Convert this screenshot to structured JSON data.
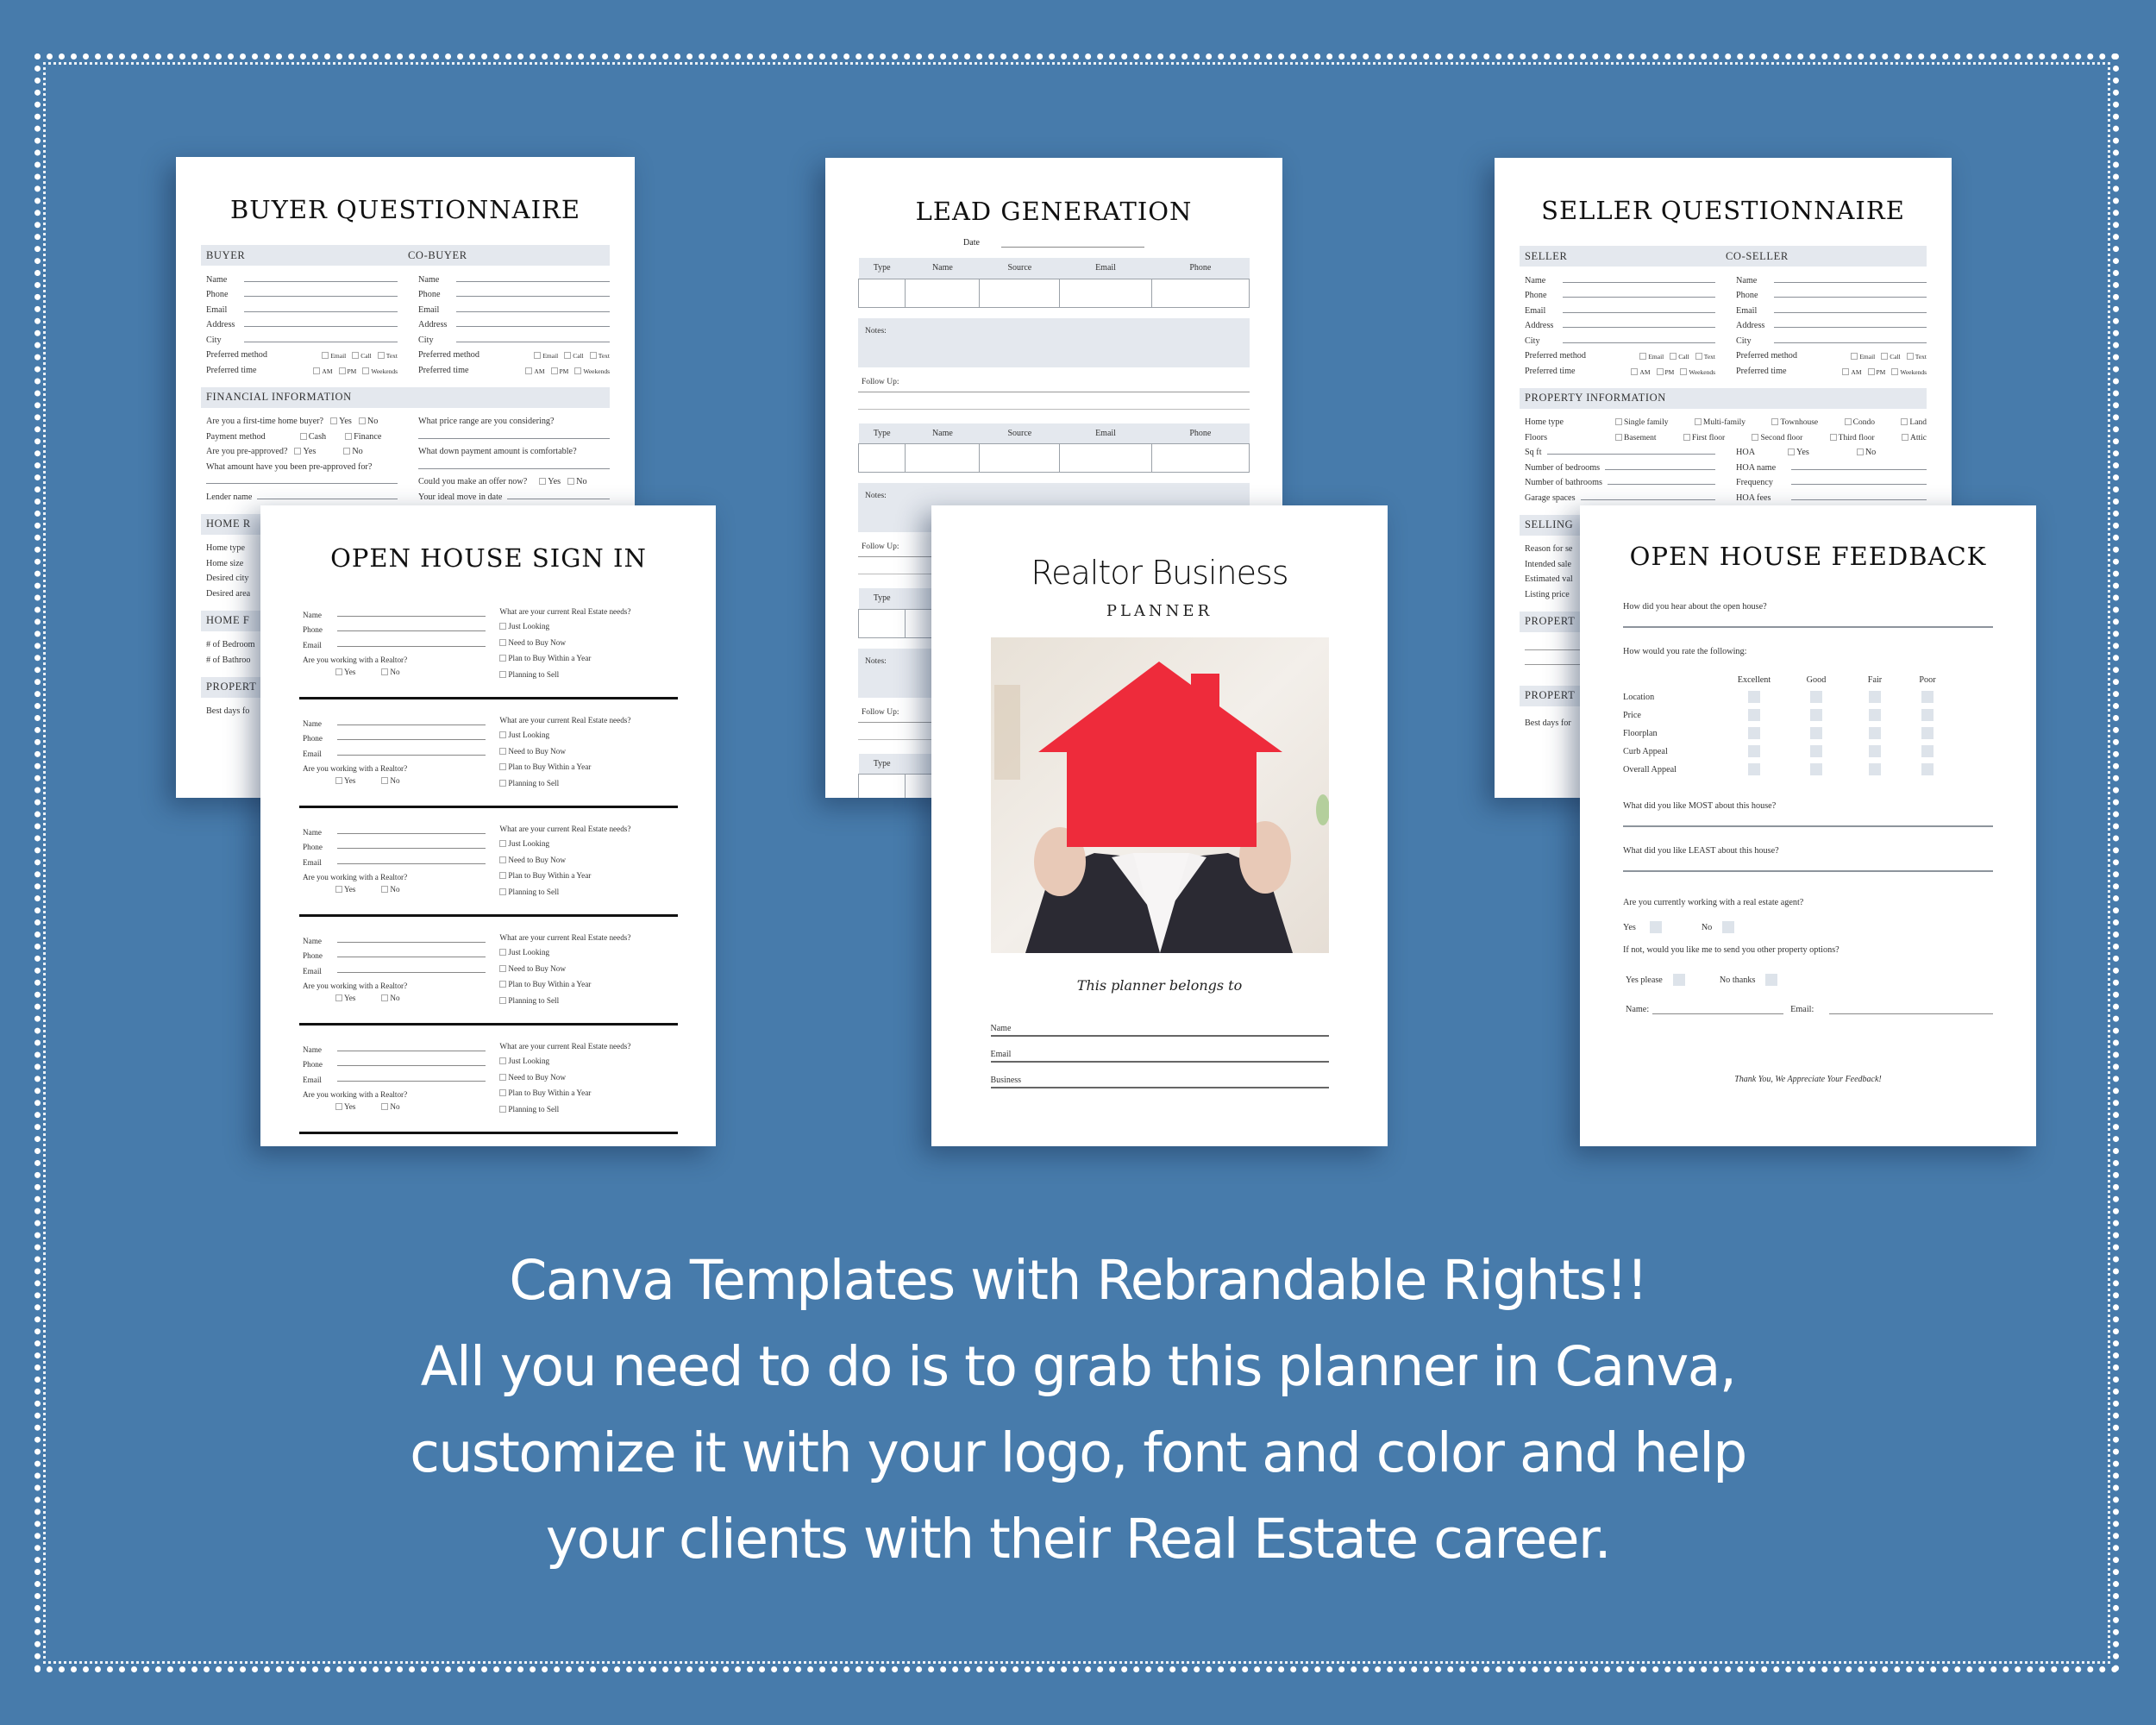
{
  "background_color": "#477bab",
  "buyer": {
    "title": "BUYER QUESTIONNAIRE",
    "section_buyer": "BUYER",
    "section_cobuyer": "CO-BUYER",
    "fields": [
      "Name",
      "Phone",
      "Email",
      "Address",
      "City"
    ],
    "preferred_method": "Preferred method",
    "method_options": [
      "Email",
      "Call",
      "Text"
    ],
    "preferred_time": "Preferred time",
    "time_options": [
      "AM",
      "PM",
      "Weekends"
    ],
    "financial_title": "FINANCIAL INFORMATION",
    "first_time": "Are you a first-time home buyer?",
    "payment_method": "Payment method",
    "cash": "Cash",
    "finance": "Finance",
    "preapproved": "Are you pre-approved?",
    "yes": "Yes",
    "no": "No",
    "preapproved_amount": "What amount have you been pre-approved for?",
    "lender": "Lender name",
    "price_range": "What price range are you considering?",
    "down_payment": "What down payment amount is comfortable?",
    "offer_now": "Could you make an offer now?",
    "move_date": "Your ideal move in date",
    "home_req_title": "HOME R",
    "home_req_fields": [
      "Home type",
      "Home size",
      "Desired city",
      "Desired area"
    ],
    "home_feat_title": "HOME F",
    "home_feat_fields": [
      "# of Bedroom",
      "# of Bathroo"
    ],
    "property_title": "PROPERT",
    "property_fields": [
      "Best days fo"
    ]
  },
  "lead": {
    "title": "LEAD GENERATION",
    "date_label": "Date",
    "columns": [
      "Type",
      "Name",
      "Source",
      "Email",
      "Phone"
    ],
    "notes_label": "Notes:",
    "follow_label": "Follow Up:"
  },
  "seller": {
    "title": "SELLER QUESTIONNAIRE",
    "section_seller": "SELLER",
    "section_coseller": "CO-SELLER",
    "fields": [
      "Name",
      "Phone",
      "Email",
      "Address",
      "City"
    ],
    "preferred_method": "Preferred method",
    "method_options": [
      "Email",
      "Call",
      "Text"
    ],
    "preferred_time": "Preferred time",
    "time_options": [
      "AM",
      "PM",
      "Weekends"
    ],
    "property_title": "PROPERTY INFORMATION",
    "home_type": "Home type",
    "home_type_options": [
      "Single family",
      "Multi-family",
      "Townhouse",
      "Condo",
      "Land"
    ],
    "floors": "Floors",
    "floor_options": [
      "Basement",
      "First floor",
      "Second floor",
      "Third floor",
      "Attic"
    ],
    "sqft": "Sq ft",
    "bedrooms": "Number of bedrooms",
    "bathrooms": "Number of bathrooms",
    "garage": "Garage spaces",
    "hoa": "HOA",
    "hoa_name": "HOA name",
    "frequency": "Frequency",
    "hoa_fees": "HOA fees",
    "yes": "Yes",
    "no": "No",
    "selling_title": "SELLING",
    "selling_fields": [
      "Reason for se",
      "Intended sale",
      "Estimated val",
      "Listing price"
    ],
    "property2_title": "PROPERT",
    "property3_title": "PROPERT",
    "property3_fields": [
      "Best days for"
    ]
  },
  "signin": {
    "title": "OPEN HOUSE SIGN IN",
    "fields": [
      "Name",
      "Phone",
      "Email"
    ],
    "realtor_q": "Are you working with a Realtor?",
    "yes": "Yes",
    "no": "No",
    "needs_q": "What are your current Real Estate needs?",
    "needs": [
      "Just Looking",
      "Need to Buy Now",
      "Plan to Buy Within a Year",
      "Planning to Sell"
    ],
    "entry_count": 5
  },
  "cover": {
    "title": "Realtor Business",
    "subtitle": "PLANNER",
    "photo_alt": "woman holding red paper house",
    "belongs": "This planner belongs to",
    "fields": [
      "Name",
      "Email",
      "Business"
    ]
  },
  "feedback": {
    "title": "OPEN HOUSE FEEDBACK",
    "q_hear": "How did you hear about the open house?",
    "q_rate": "How would you rate the following:",
    "rating_cols": [
      "Excellent",
      "Good",
      "Fair",
      "Poor"
    ],
    "rating_rows": [
      "Location",
      "Price",
      "Floorplan",
      "Curb Appeal",
      "Overall Appeal"
    ],
    "q_most": "What did you like MOST about this house?",
    "q_least": "What did you like LEAST about this house?",
    "q_agent": "Are you currently working with a real estate agent?",
    "yes": "Yes",
    "no": "No",
    "q_options": "If not, would you like me to send you other property options?",
    "yes_please": "Yes please",
    "no_thanks": "No thanks",
    "name_label": "Name:",
    "email_label": "Email:",
    "thanks": "Thank You, We Appreciate Your Feedback!"
  },
  "promo": {
    "lines": [
      "Canva Templates with Rebrandable Rights!!",
      "All you need to do is to grab this planner in Canva,",
      "customize it with your logo, font and color and help",
      "your clients with their Real Estate career."
    ]
  }
}
